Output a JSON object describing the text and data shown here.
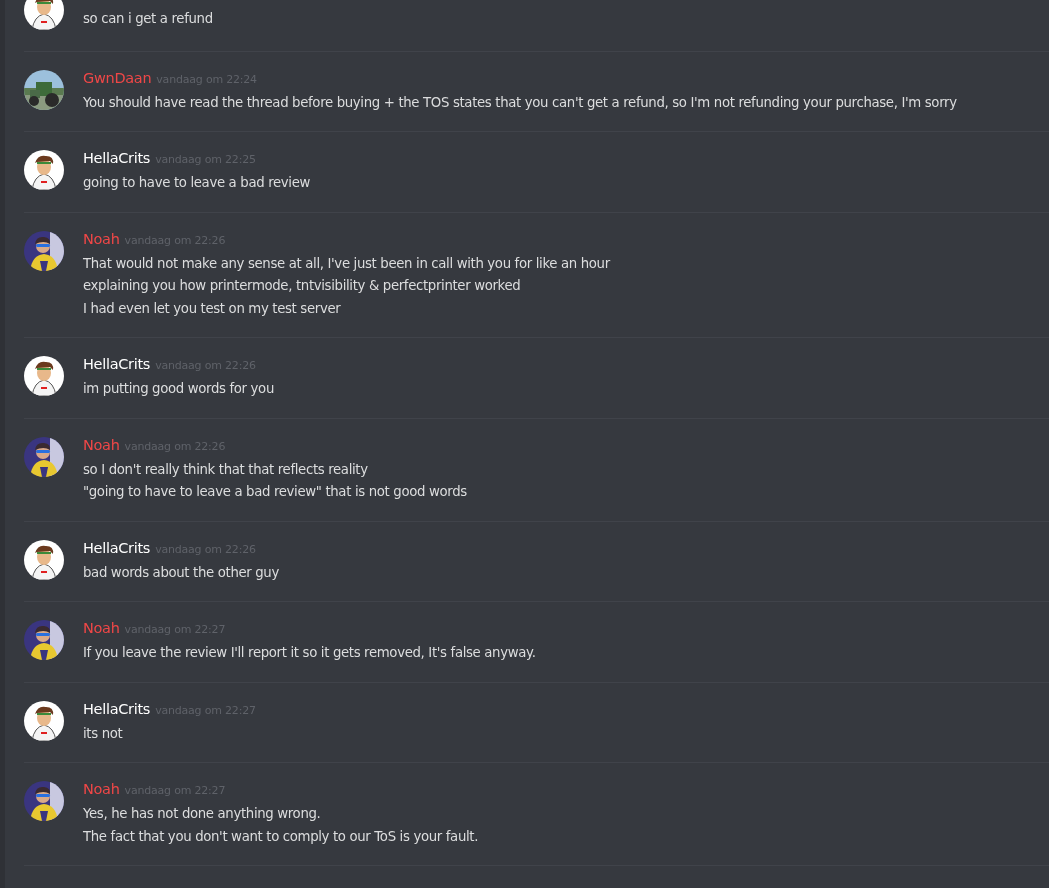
{
  "messages": [
    {
      "avatar": {
        "kind": "cartoon"
      },
      "lines": [
        "so can i get a refund"
      ]
    },
    {
      "avatar": {
        "kind": "tractor"
      },
      "author": "GwnDaan",
      "color": "#f04747",
      "time": "vandaag om 22:24",
      "lines": [
        "You should have read the thread before buying + the TOS states that you can't get a refund, so I'm not refunding your purchase, I'm sorry"
      ]
    },
    {
      "avatar": {
        "kind": "cartoon"
      },
      "author": "HellaCrits",
      "color": "#ffffff",
      "time": "vandaag om 22:25",
      "lines": [
        "going to have to leave a bad review"
      ]
    },
    {
      "avatar": {
        "kind": "person"
      },
      "author": "Noah",
      "color": "#f04747",
      "time": "vandaag om 22:26",
      "lines": [
        "That would not make any sense at all, I've just been in call with you for like an hour",
        "explaining you how printermode, tntvisibility & perfectprinter worked",
        "I had even let you test on my test server"
      ]
    },
    {
      "avatar": {
        "kind": "cartoon"
      },
      "author": "HellaCrits",
      "color": "#ffffff",
      "time": "vandaag om 22:26",
      "lines": [
        "im putting good words for you"
      ]
    },
    {
      "avatar": {
        "kind": "person"
      },
      "author": "Noah",
      "color": "#f04747",
      "time": "vandaag om 22:26",
      "lines": [
        "so I don't really think that that reflects reality",
        "\"going to have to leave a bad review\" that is not good words"
      ]
    },
    {
      "avatar": {
        "kind": "cartoon"
      },
      "author": "HellaCrits",
      "color": "#ffffff",
      "time": "vandaag om 22:26",
      "lines": [
        "bad words about the other guy"
      ]
    },
    {
      "avatar": {
        "kind": "person"
      },
      "author": "Noah",
      "color": "#f04747",
      "time": "vandaag om 22:27",
      "lines": [
        "If you leave the review I'll report it so it gets removed, It's false anyway."
      ]
    },
    {
      "avatar": {
        "kind": "cartoon"
      },
      "author": "HellaCrits",
      "color": "#ffffff",
      "time": "vandaag om 22:27",
      "lines": [
        "its not"
      ]
    },
    {
      "avatar": {
        "kind": "person"
      },
      "author": "Noah",
      "color": "#f04747",
      "time": "vandaag om 22:27",
      "lines": [
        "Yes, he has not done anything wrong.",
        "The fact that you don't want to comply to our ToS is your fault."
      ]
    }
  ]
}
